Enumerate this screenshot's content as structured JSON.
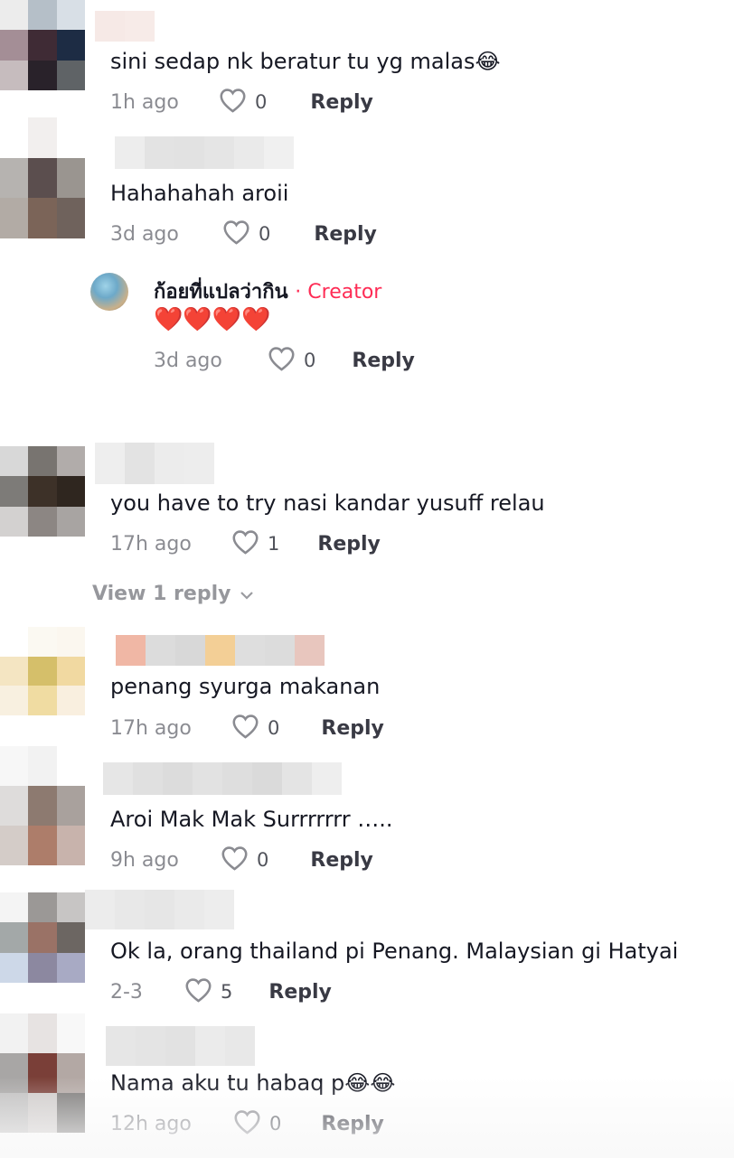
{
  "comments": [
    {
      "text": "sini sedap nk beratur tu yg malas😂",
      "time": "1h ago",
      "likes": "0",
      "reply_label": "Reply",
      "avatar_colors": [
        "#ececec",
        "#b5bfc8",
        "#d8dfe6",
        "#a48e96",
        "#3f2b35",
        "#1d2c44",
        "#c6bcbe",
        "#29222a",
        "#5f6366"
      ],
      "name_colors": [
        "#f6e9e6",
        "#f7ebe8"
      ]
    },
    {
      "text": "Hahahahah aroii",
      "time": "3d ago",
      "likes": "0",
      "reply_label": "Reply",
      "avatar_colors": [
        "#ffffff",
        "#f2efee",
        "#ffffff",
        "#b6b3b0",
        "#5b4e4e",
        "#9a9590",
        "#b2aba5",
        "#7b6458",
        "#6f625c"
      ],
      "name_colors": [
        "#ededed",
        "#e3e3e3",
        "#e2e2e2",
        "#e5e5e5",
        "#eaeaea",
        "#f0f0f0"
      ],
      "replies": [
        {
          "author": "ก้อยที่แปลว่ากิน",
          "badge": "· Creator",
          "text": "❤️❤️❤️❤️",
          "time": "3d ago",
          "likes": "0",
          "reply_label": "Reply"
        }
      ]
    },
    {
      "text": "you have to try nasi kandar yusuff relau",
      "time": "17h ago",
      "likes": "1",
      "reply_label": "Reply",
      "view_replies": "View 1 reply",
      "avatar_colors": [
        "#d8d8d8",
        "#787470",
        "#b1acaa",
        "#7d7b78",
        "#3d3128",
        "#2f261f",
        "#d3d1d0",
        "#8c8683",
        "#a8a4a2"
      ],
      "name_colors": [
        "#eeeeee",
        "#e3e3e3",
        "#ececec",
        "#ededed"
      ]
    },
    {
      "text": "penang syurga makanan",
      "time": "17h ago",
      "likes": "0",
      "reply_label": "Reply",
      "avatar_colors": [
        "#ffffff",
        "#fbf9f2",
        "#fbf7ef",
        "#f4e5c2",
        "#d5bf6a",
        "#f1d9a1",
        "#f8f0e0",
        "#f0dca2",
        "#f9efdf"
      ],
      "name_colors": [
        "#f0b7a5",
        "#dcdcdc",
        "#d8d8d8",
        "#f3cf96",
        "#dedede",
        "#dcdcdc",
        "#e8c6be"
      ]
    },
    {
      "text": "Aroi Mak Mak Surrrrrrr …..",
      "time": "9h ago",
      "likes": "0",
      "reply_label": "Reply",
      "avatar_colors": [
        "#f7f7f7",
        "#f2f2f2",
        "#ffffff",
        "#dedcdb",
        "#8d7a70",
        "#a9a19d",
        "#d4ccc8",
        "#ad7d6a",
        "#c8b3ac"
      ],
      "name_colors": [
        "#e6e6e6",
        "#e0e0e0",
        "#dcdcdc",
        "#e2e2e2",
        "#dedede",
        "#dadada",
        "#e4e4e4",
        "#eeeeee"
      ]
    },
    {
      "text": "Ok la, orang thailand pi Penang. Malaysian gi Hatyai",
      "time": "2-3",
      "likes": "5",
      "reply_label": "Reply",
      "avatar_colors": [
        "#f4f4f4",
        "#9b9896",
        "#c7c5c4",
        "#a3a8a8",
        "#9a7266",
        "#6c6662",
        "#cdd8e8",
        "#8c88a0",
        "#a8aac4"
      ],
      "name_colors": [
        "#ececec",
        "#e8e8e8",
        "#e6e6e6",
        "#eaeaea",
        "#ededed"
      ]
    },
    {
      "text": "Nama aku tu habaq p😂😂",
      "time": "12h ago",
      "likes": "0",
      "reply_label": "Reply",
      "avatar_colors": [
        "#f2f2f2",
        "#e7e3e2",
        "#f8f8f8",
        "#a8a6a5",
        "#7a3f38",
        "#b3a8a4",
        "#c0bfbf",
        "#cfcbca",
        "#7a7877"
      ],
      "name_colors": [
        "#e6e6e6",
        "#e4e4e4",
        "#e2e2e2",
        "#ebebeb",
        "#e8e8e8"
      ]
    }
  ]
}
